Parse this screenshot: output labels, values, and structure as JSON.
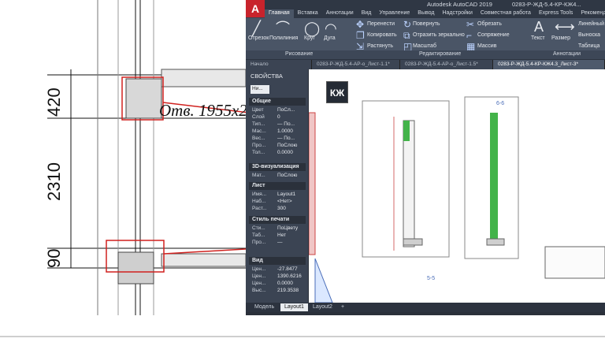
{
  "drawing": {
    "dims": [
      "420",
      "2310",
      "90"
    ],
    "opening_label": "Отв. 1955x2"
  },
  "window": {
    "logo": "A",
    "title": "Autodesk AutoCAD 2019",
    "file_title": "0283-Р-ЖД-5.4-КР-КЖ4..."
  },
  "ribbon": {
    "tabs": [
      "Главная",
      "Вставка",
      "Аннотации",
      "Вид",
      "Управление",
      "Вывод",
      "Надстройки",
      "Совместная работа",
      "Express Tools",
      "Рекомендованные"
    ],
    "draw_tools": [
      "Отрезок",
      "Полилиния",
      "Круг",
      "Дуга"
    ],
    "modify_tools": [
      "Перенести",
      "Повернуть",
      "Обрезать",
      "Копировать",
      "Отразить зеркально",
      "Сопряжение",
      "Растянуть",
      "Масштаб",
      "Массив"
    ],
    "annotation_tools": [
      "Текст",
      "Размер",
      "Линейный",
      "Выноска",
      "Таблица"
    ],
    "panels": [
      "Рисование",
      "Редактирование",
      "Аннотации"
    ]
  },
  "doc_tabs": [
    "Начало",
    "0283-Р-ЖД-5.4-АР-о_Лист-1.1*",
    "0283-Р-ЖД-5.4-АР-о_Лист-1.5*",
    "0283-Р-ЖД-5.4-КР-КЖ4.3_Лист-3*"
  ],
  "properties": {
    "title": "СВОЙСТВА",
    "selector": "Ни...",
    "sections": [
      {
        "name": "Общие",
        "rows": [
          [
            "Цвет",
            "ПоСл..."
          ],
          [
            "Слой",
            "0"
          ],
          [
            "Тип...",
            "— По..."
          ],
          [
            "Мас...",
            "1.0000"
          ],
          [
            "Вес...",
            "— По..."
          ],
          [
            "Про...",
            "ПоСлою"
          ],
          [
            "Тол...",
            "0.0000"
          ]
        ]
      },
      {
        "name": "3D-визуализация",
        "rows": [
          [
            "Мат...",
            "ПоСлою"
          ]
        ]
      },
      {
        "name": "Лист",
        "rows": [
          [
            "Имя...",
            "Layout1"
          ],
          [
            "Наб...",
            "<Нет>"
          ],
          [
            "Раст...",
            "300"
          ]
        ]
      },
      {
        "name": "Стиль печати",
        "rows": [
          [
            "Сти...",
            "ПоЦвету"
          ],
          [
            "Таб...",
            "Нет"
          ],
          [
            "Про...",
            "—"
          ]
        ]
      },
      {
        "name": "Вид",
        "rows": [
          [
            "Цен...",
            "-27.8477"
          ],
          [
            "Цен...",
            "1390.6216"
          ],
          [
            "Цен...",
            "0.0000"
          ],
          [
            "Выс...",
            "219.3538"
          ]
        ]
      }
    ]
  },
  "canvas": {
    "badge": "КЖ",
    "section_labels": [
      "5-5",
      "6-6"
    ]
  },
  "layout_tabs": [
    "Модель",
    "Layout1",
    "Layout2",
    "+"
  ]
}
